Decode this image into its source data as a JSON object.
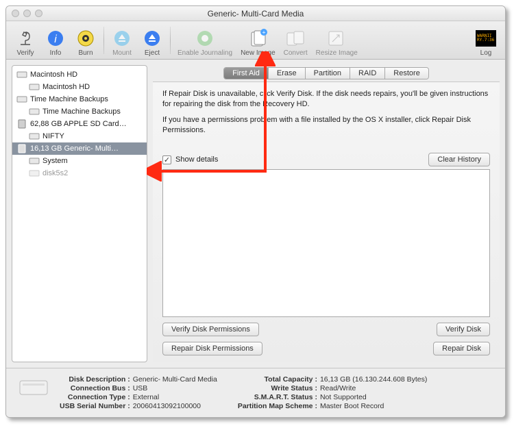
{
  "window": {
    "title": "Generic- Multi-Card Media"
  },
  "toolbar": {
    "verify": "Verify",
    "info": "Info",
    "burn": "Burn",
    "mount": "Mount",
    "eject": "Eject",
    "enable_journaling": "Enable Journaling",
    "new_image": "New Image",
    "convert": "Convert",
    "resize_image": "Resize Image",
    "log": "Log"
  },
  "sidebar": {
    "items": [
      {
        "label": "Macintosh HD",
        "icon": "hdd"
      },
      {
        "label": "Macintosh HD",
        "icon": "hdd",
        "child": true
      },
      {
        "label": "Time Machine Backups",
        "icon": "hdd"
      },
      {
        "label": "Time Machine Backups",
        "icon": "hdd",
        "child": true
      },
      {
        "label": "62,88 GB APPLE SD Card…",
        "icon": "sd"
      },
      {
        "label": "NIFTY",
        "icon": "hdd",
        "child": true
      },
      {
        "label": "16,13 GB Generic- Multi…",
        "icon": "sd",
        "selected": true
      },
      {
        "label": "System",
        "icon": "hdd",
        "child": true
      },
      {
        "label": "disk5s2",
        "icon": "hdd",
        "child": true,
        "dim": true
      }
    ]
  },
  "tabs": {
    "first_aid": "First Aid",
    "erase": "Erase",
    "partition": "Partition",
    "raid": "RAID",
    "restore": "Restore"
  },
  "help": {
    "p1": "If Repair Disk is unavailable, click Verify Disk. If the disk needs repairs, you'll be given instructions for repairing the disk from the Recovery HD.",
    "p2": "If you have a permissions problem with a file installed by the OS X installer, click Repair Disk Permissions."
  },
  "show_details": "Show details",
  "buttons": {
    "clear_history": "Clear History",
    "verify_disk_permissions": "Verify Disk Permissions",
    "verify_disk": "Verify Disk",
    "repair_disk_permissions": "Repair Disk Permissions",
    "repair_disk": "Repair Disk"
  },
  "footer": {
    "left": {
      "disk_description_k": "Disk Description",
      "disk_description_v": "Generic- Multi-Card Media",
      "connection_bus_k": "Connection Bus",
      "connection_bus_v": "USB",
      "connection_type_k": "Connection Type",
      "connection_type_v": "External",
      "usb_serial_k": "USB Serial Number",
      "usb_serial_v": "20060413092100000"
    },
    "right": {
      "total_capacity_k": "Total Capacity",
      "total_capacity_v": "16,13 GB (16.130.244.608 Bytes)",
      "write_status_k": "Write Status",
      "write_status_v": "Read/Write",
      "smart_k": "S.M.A.R.T. Status",
      "smart_v": "Not Supported",
      "partition_scheme_k": "Partition Map Scheme",
      "partition_scheme_v": "Master Boot Record"
    }
  }
}
